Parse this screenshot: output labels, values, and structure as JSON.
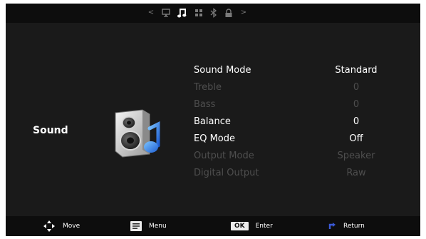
{
  "topnav": {
    "left_arrow": "<",
    "right_arrow": ">",
    "icons": [
      "picture-icon",
      "sound-icon",
      "channel-icon",
      "bluetooth-icon",
      "lock-icon"
    ],
    "active_index": 1
  },
  "category": "Sound",
  "menu": {
    "items": [
      {
        "label": "Sound Mode",
        "value": "Standard",
        "enabled": true
      },
      {
        "label": "Treble",
        "value": "0",
        "enabled": false
      },
      {
        "label": "Bass",
        "value": "0",
        "enabled": false
      },
      {
        "label": "Balance",
        "value": "0",
        "enabled": true
      },
      {
        "label": "EQ Mode",
        "value": "Off",
        "enabled": true
      },
      {
        "label": "Output Mode",
        "value": "Speaker",
        "enabled": false
      },
      {
        "label": "Digital Output",
        "value": "Raw",
        "enabled": false
      }
    ]
  },
  "footer": {
    "move": "Move",
    "menu": "Menu",
    "ok_key": "OK",
    "enter": "Enter",
    "return": "Return"
  },
  "colors": {
    "background": "#1a1a1a",
    "bars": "#0d0d0d",
    "enabled_text": "#ffffff",
    "disabled_text": "#4e4e4e",
    "return_accent": "#3a59d6"
  }
}
